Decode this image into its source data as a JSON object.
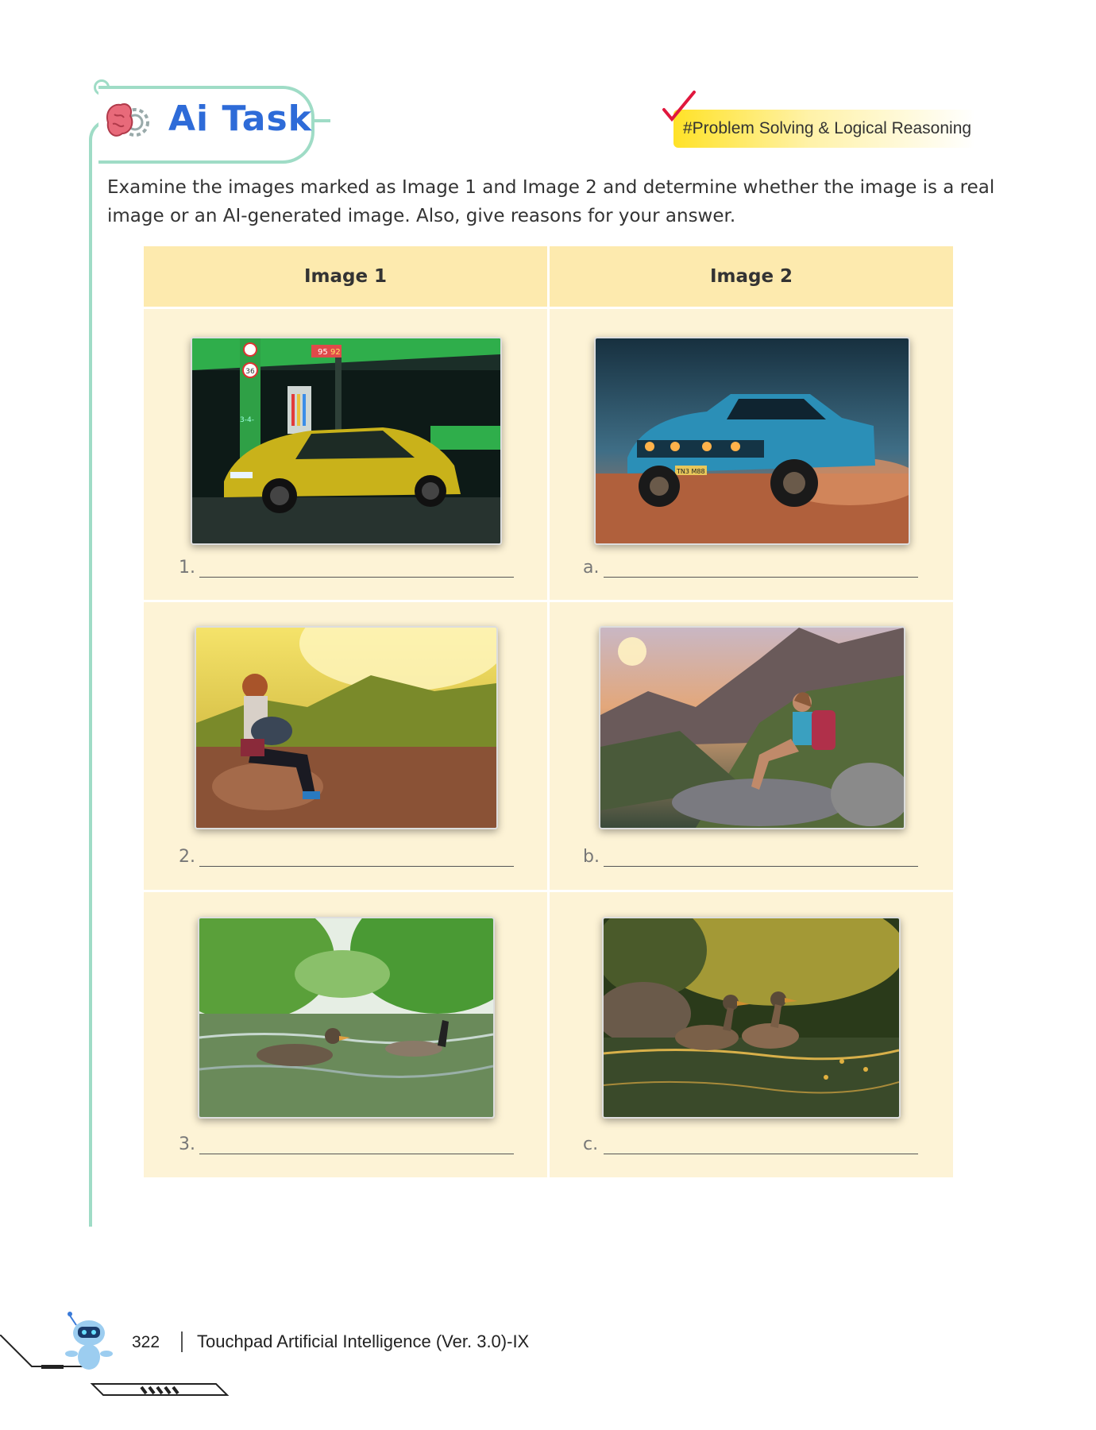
{
  "header": {
    "badge_title": "Ai Task",
    "tag": "#Problem Solving & Logical Reasoning"
  },
  "instructions": "Examine the images marked as Image 1 and Image 2 and determine whether the image is a real image or an AI-generated image. Also, give reasons for your answer.",
  "table": {
    "col1_header": "Image 1",
    "col2_header": "Image 2",
    "rows": [
      {
        "left_label": "1.",
        "left_image": "yellow car at petrol station",
        "right_label": "a.",
        "right_image": "blue muscle car in desert",
        "sign_left_top": "95",
        "sign_left_top2": "92",
        "sign_num": "36",
        "pump_text": "3-4-",
        "plate_text": "TN3 M88"
      },
      {
        "left_label": "2.",
        "left_image": "woman sitting on rocks in mountains",
        "right_label": "b.",
        "right_image": "hiker woman looking at mountain valley"
      },
      {
        "left_label": "3.",
        "left_image": "ducks swimming in river",
        "right_label": "c.",
        "right_image": "two ducks in golden pond"
      }
    ]
  },
  "footer": {
    "page_number": "322",
    "book_title": "Touchpad Artificial Intelligence (Ver. 3.0)-IX"
  },
  "colors": {
    "accent_rail": "#9fdcc6",
    "title_blue": "#2e6bd8",
    "table_header": "#fdeaae",
    "table_body": "#fdf3d6",
    "tag_yellow": "#ffe227",
    "check_red": "#e0173d"
  },
  "icons": [
    "brain-gear-icon",
    "checkmark-icon",
    "robot-mascot-icon"
  ]
}
